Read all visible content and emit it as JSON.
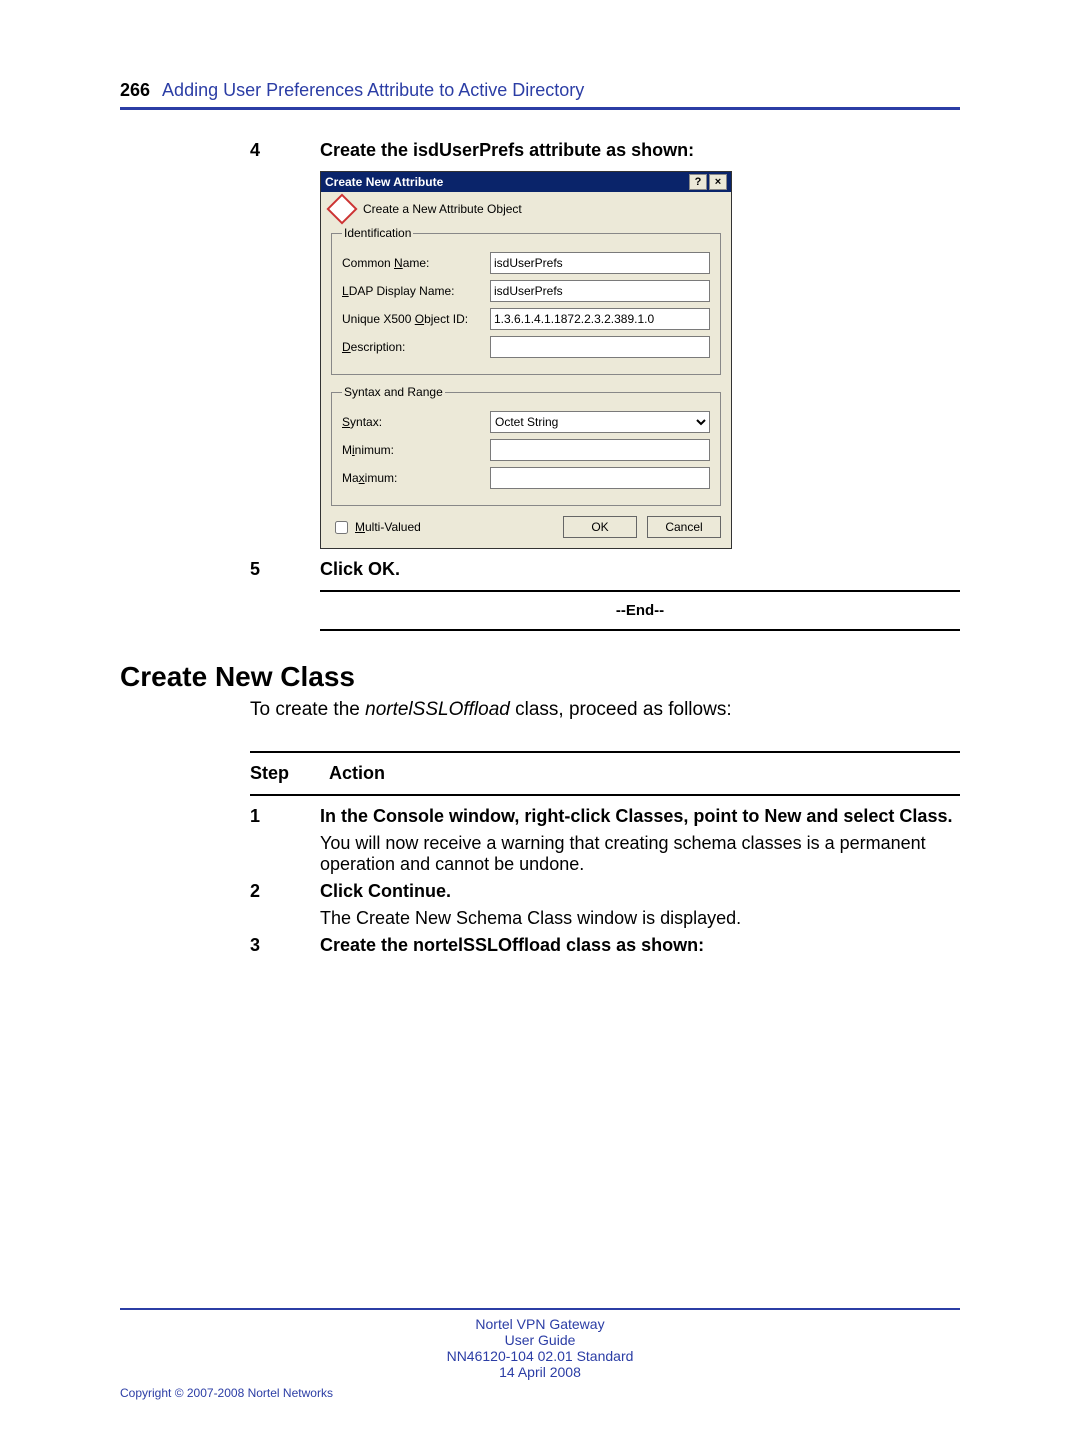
{
  "header": {
    "pageNumber": "266",
    "chapterTitle": "Adding User Preferences Attribute to Active Directory"
  },
  "topSteps": {
    "s4": {
      "num": "4",
      "text": "Create the isdUserPrefs attribute as shown:"
    },
    "s5": {
      "num": "5",
      "text": "Click OK."
    },
    "endLabel": "--End--"
  },
  "dialog": {
    "title": "Create New Attribute",
    "helpBtn": "?",
    "closeBtn": "×",
    "promptText": "Create a New Attribute Object",
    "identGroup": "Identification",
    "commonNameLabel": "Common Name:",
    "commonNameValue": "isdUserPrefs",
    "ldapLabel": "LDAP Display Name:",
    "ldapValue": "isdUserPrefs",
    "oidLabel": "Unique X500 Object ID:",
    "oidValue": "1.3.6.1.4.1.1872.2.3.2.389.1.0",
    "descLabel": "Description:",
    "descValue": "",
    "syntaxGroup": "Syntax and Range",
    "syntaxLabel": "Syntax:",
    "syntaxValue": "Octet String",
    "minLabel": "Minimum:",
    "minValue": "",
    "maxLabel": "Maximum:",
    "maxValue": "",
    "multiLabel": "Multi-Valued",
    "okBtn": "OK",
    "cancelBtn": "Cancel"
  },
  "section": {
    "heading": "Create New Class",
    "intro_a": "To create the ",
    "intro_em": "nortelSSLOffload",
    "intro_b": " class, proceed as follows:"
  },
  "table": {
    "stepHdr": "Step",
    "actionHdr": "Action",
    "r1": {
      "num": "1",
      "bold": "In the Console window, right-click Classes, point to New and select Class.",
      "text": "You will now receive a warning that creating schema classes is a permanent operation and cannot be undone."
    },
    "r2": {
      "num": "2",
      "bold": "Click Continue.",
      "text": "The Create New Schema Class window is displayed."
    },
    "r3": {
      "num": "3",
      "bold": "Create the nortelSSLOffload class as shown:"
    }
  },
  "footer": {
    "line1": "Nortel VPN Gateway",
    "line2": "User Guide",
    "line3a": "NN46120-104   02.01   ",
    "line3b": "Standard",
    "line4": "14 April 2008",
    "copyright": "Copyright © 2007-2008 Nortel Networks"
  }
}
